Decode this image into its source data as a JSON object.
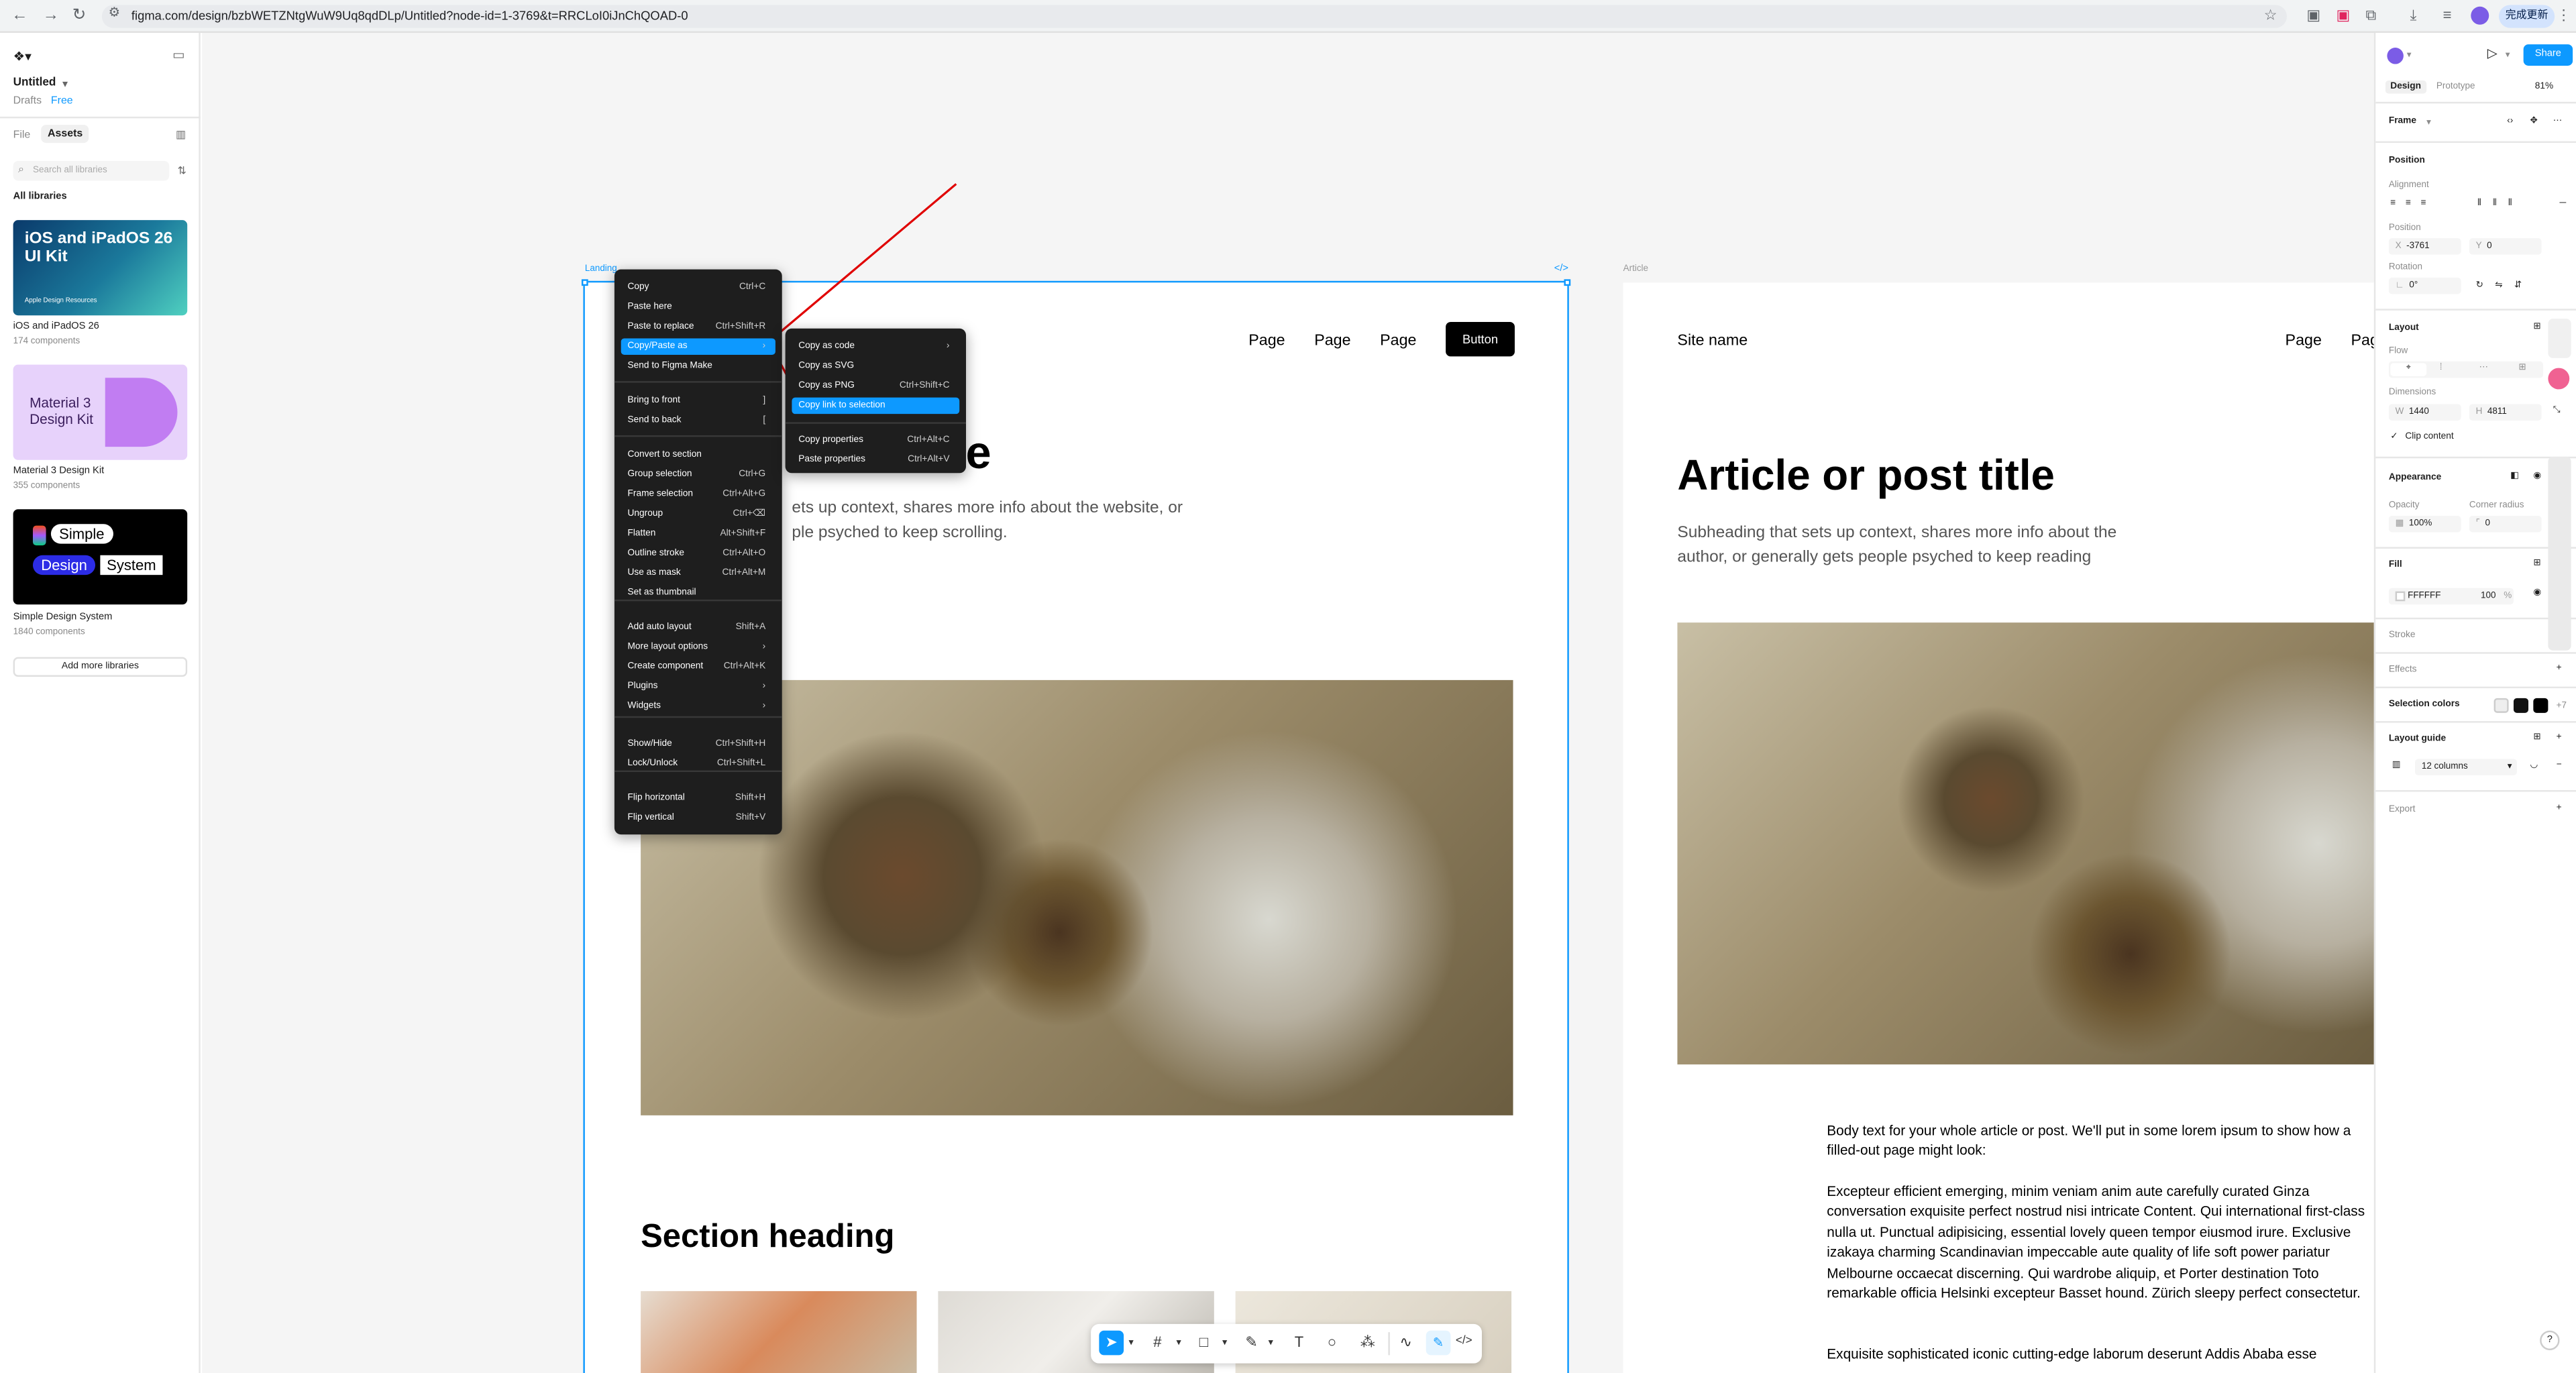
{
  "browser": {
    "url": "figma.com/design/bzbWETZNtgWuW9Uq8qdDLp/Untitled?node-id=1-3769&t=RRCLoI0iJnChQOAD-0",
    "update_label": "完成更新"
  },
  "left": {
    "file_name": "Untitled",
    "drafts": "Drafts",
    "plan": "Free",
    "tab_file": "File",
    "tab_assets": "Assets",
    "search_placeholder": "Search all libraries",
    "all_libraries": "All libraries",
    "libraries": [
      {
        "name": "iOS and iPadOS 26",
        "count": "174 components",
        "thumb_title": "iOS and iPadOS 26 UI Kit",
        "thumb_sub": "Apple Design Resources"
      },
      {
        "name": "Material 3 Design Kit",
        "count": "355 components",
        "thumb_title": "Material 3 Design Kit"
      },
      {
        "name": "Simple Design System",
        "count": "1840 components",
        "thumb_w1": "Simple",
        "thumb_w2": "Design",
        "thumb_w3": "System"
      }
    ],
    "add_libraries": "Add more libraries"
  },
  "canvas": {
    "frame1_label": "Landing",
    "frame2_label": "Article",
    "f1": {
      "nav": [
        "Page",
        "Page",
        "Page"
      ],
      "button": "Button",
      "title_fragment": "le",
      "subtitle_line1": "ets up context, shares more info about the website, or",
      "subtitle_line2": "ple psyched to keep scrolling.",
      "section_heading": "Section heading"
    },
    "f2": {
      "site_name": "Site name",
      "nav1": "Page",
      "nav2": "Pag",
      "title": "Article or post title",
      "subtitle": "Subheading that sets up context, shares more info about the author, or generally gets people psyched to keep reading",
      "body1": "Body text for your whole article or post. We'll put in some lorem ipsum to show how a filled-out page might look:",
      "body2": "Excepteur efficient emerging, minim veniam anim aute carefully curated Ginza conversation exquisite perfect nostrud nisi intricate Content. Qui  international first-class nulla ut. Punctual adipisicing, essential lovely queen tempor eiusmod irure. Exclusive izakaya charming Scandinavian impeccable aute quality of life soft power pariatur Melbourne occaecat discerning. Qui wardrobe aliquip, et Porter destination Toto remarkable officia Helsinki excepteur Basset hound. Zürich sleepy perfect consectetur.",
      "body3": "Exquisite sophisticated iconic cutting-edge laborum deserunt Addis Ababa esse"
    }
  },
  "context_menu": {
    "items": [
      {
        "label": "Copy",
        "shortcut": "Ctrl+C"
      },
      {
        "label": "Paste here",
        "shortcut": ""
      },
      {
        "label": "Paste to replace",
        "shortcut": "Ctrl+Shift+R"
      },
      {
        "label": "Copy/Paste as",
        "shortcut": "›"
      },
      {
        "label": "Send to Figma Make",
        "shortcut": ""
      },
      {
        "label": "Bring to front",
        "shortcut": "]"
      },
      {
        "label": "Send to back",
        "shortcut": "["
      },
      {
        "label": "Convert to section",
        "shortcut": ""
      },
      {
        "label": "Group selection",
        "shortcut": "Ctrl+G"
      },
      {
        "label": "Frame selection",
        "shortcut": "Ctrl+Alt+G"
      },
      {
        "label": "Ungroup",
        "shortcut": "Ctrl+⌫"
      },
      {
        "label": "Flatten",
        "shortcut": "Alt+Shift+F"
      },
      {
        "label": "Outline stroke",
        "shortcut": "Ctrl+Alt+O"
      },
      {
        "label": "Use as mask",
        "shortcut": "Ctrl+Alt+M"
      },
      {
        "label": "Set as thumbnail",
        "shortcut": ""
      },
      {
        "label": "Add auto layout",
        "shortcut": "Shift+A"
      },
      {
        "label": "More layout options",
        "shortcut": "›"
      },
      {
        "label": "Create component",
        "shortcut": "Ctrl+Alt+K"
      },
      {
        "label": "Plugins",
        "shortcut": "›"
      },
      {
        "label": "Widgets",
        "shortcut": "›"
      },
      {
        "label": "Show/Hide",
        "shortcut": "Ctrl+Shift+H"
      },
      {
        "label": "Lock/Unlock",
        "shortcut": "Ctrl+Shift+L"
      },
      {
        "label": "Flip horizontal",
        "shortcut": "Shift+H"
      },
      {
        "label": "Flip vertical",
        "shortcut": "Shift+V"
      }
    ]
  },
  "submenu": {
    "items": [
      {
        "label": "Copy as code",
        "shortcut": "›"
      },
      {
        "label": "Copy as SVG",
        "shortcut": ""
      },
      {
        "label": "Copy as PNG",
        "shortcut": "Ctrl+Shift+C"
      },
      {
        "label": "Copy link to selection",
        "shortcut": ""
      },
      {
        "label": "Copy properties",
        "shortcut": "Ctrl+Alt+C"
      },
      {
        "label": "Paste properties",
        "shortcut": "Ctrl+Alt+V"
      }
    ]
  },
  "right": {
    "share": "Share",
    "tab_design": "Design",
    "tab_prototype": "Prototype",
    "zoom": "81%",
    "frame": "Frame",
    "position": "Position",
    "alignment": "Alignment",
    "position_label": "Position",
    "x_label": "X",
    "x": "-3761",
    "y_label": "Y",
    "y": "0",
    "rotation": "Rotation",
    "rotation_value": "0°",
    "layout": "Layout",
    "flow": "Flow",
    "dimensions": "Dimensions",
    "w_label": "W",
    "w": "1440",
    "h_label": "H",
    "h": "4811",
    "clip": "Clip content",
    "appearance": "Appearance",
    "opacity_label": "Opacity",
    "opacity": "100%",
    "radius_label": "Corner radius",
    "radius": "0",
    "fill": "Fill",
    "fill_hex": "FFFFFF",
    "fill_opacity": "100",
    "fill_pct": "%",
    "stroke": "Stroke",
    "effects": "Effects",
    "selection_colors": "Selection colors",
    "sel_more": "+7",
    "layout_guide": "Layout guide",
    "guide_value": "12 columns",
    "export": "Export",
    "help": "?"
  },
  "colors": {
    "accent": "#0d99ff",
    "menu_bg": "#1e1e1e",
    "arrow": "#e00000"
  }
}
